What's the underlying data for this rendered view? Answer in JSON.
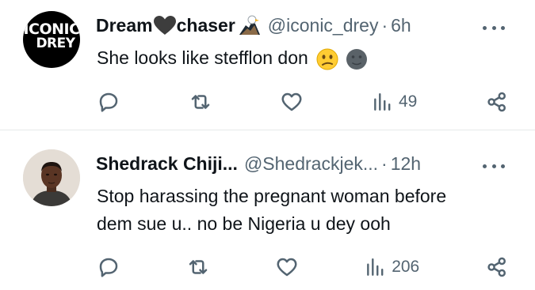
{
  "tweets": [
    {
      "display_name": "Dream",
      "display_name_suffix": "chaser",
      "avatar_text_line1": "ICONIC",
      "avatar_text_line2": "DREY",
      "handle": "@iconic_drey",
      "separator": "·",
      "time": "6h",
      "text_lines": [
        "She looks like stefflon don"
      ],
      "views": "49",
      "icons": [
        "black-heart-emoji",
        "eagle-emoji",
        "slightly-frowning-face-emoji",
        "new-moon-face-emoji"
      ]
    },
    {
      "display_name": "Shedrack Chiji...",
      "handle": "@Shedrackjek...",
      "separator": "·",
      "time": "12h",
      "text_lines": [
        "Stop harassing the pregnant woman before",
        "dem sue u.. no be Nigeria u dey ooh"
      ],
      "views": "206"
    }
  ],
  "colors": {
    "text": "#0f1419",
    "secondary": "#536471",
    "divider": "#e6e9ea"
  }
}
